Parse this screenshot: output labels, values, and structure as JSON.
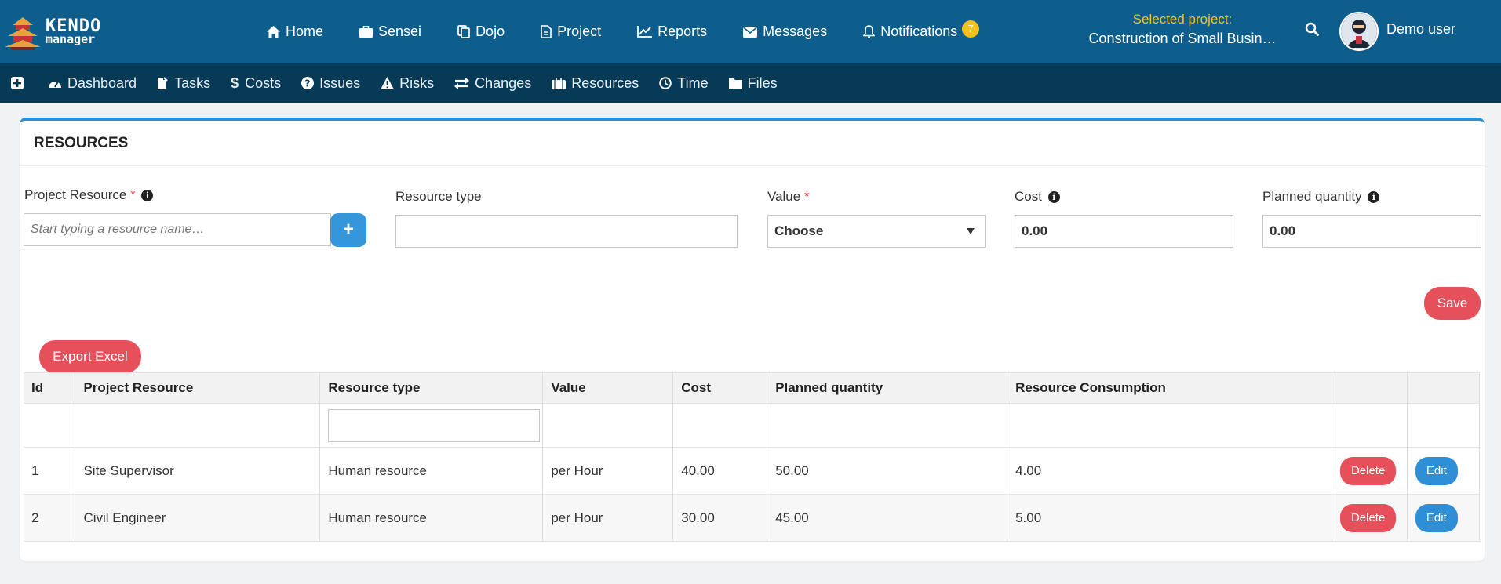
{
  "brand": {
    "line1": "KENDO",
    "line2": "manager"
  },
  "topnav": {
    "items": [
      {
        "label": "Home",
        "icon": "home-icon"
      },
      {
        "label": "Sensei",
        "icon": "briefcase-icon"
      },
      {
        "label": "Dojo",
        "icon": "copy-icon"
      },
      {
        "label": "Project",
        "icon": "file-icon"
      },
      {
        "label": "Reports",
        "icon": "line-chart-icon"
      },
      {
        "label": "Messages",
        "icon": "envelope-icon"
      },
      {
        "label": "Notifications",
        "icon": "bell-icon"
      }
    ],
    "notifications_count": "7",
    "selected_project_label": "Selected project:",
    "selected_project_name": "Construction of Small Busin…",
    "user_name": "Demo user"
  },
  "subnav": {
    "items": [
      {
        "label": "Dashboard",
        "icon": "dashboard-icon"
      },
      {
        "label": "Tasks",
        "icon": "tasks-icon"
      },
      {
        "label": "Costs",
        "icon": "dollar-icon"
      },
      {
        "label": "Issues",
        "icon": "question-icon"
      },
      {
        "label": "Risks",
        "icon": "warning-icon"
      },
      {
        "label": "Changes",
        "icon": "exchange-icon"
      },
      {
        "label": "Resources",
        "icon": "suitcase-icon"
      },
      {
        "label": "Time",
        "icon": "clock-icon"
      },
      {
        "label": "Files",
        "icon": "folder-icon"
      }
    ]
  },
  "panel": {
    "title": "RESOURCES",
    "form": {
      "project_resource_label": "Project Resource",
      "project_resource_placeholder": "Start typing a resource name…",
      "resource_type_label": "Resource type",
      "value_label": "Value",
      "value_selected": "Choose",
      "cost_label": "Cost",
      "cost_value": "0.00",
      "planned_quantity_label": "Planned quantity",
      "planned_quantity_value": "0.00",
      "required_mark": "*",
      "save_label": "Save"
    },
    "export_label": "Export Excel",
    "table": {
      "headers": [
        "Id",
        "Project Resource",
        "Resource type",
        "Value",
        "Cost",
        "Planned quantity",
        "Resource Consumption",
        "",
        ""
      ],
      "rows": [
        {
          "id": "1",
          "resource": "Site Supervisor",
          "type": "Human resource",
          "value": "per Hour",
          "cost": "40.00",
          "planned": "50.00",
          "consumption": "4.00"
        },
        {
          "id": "2",
          "resource": "Civil Engineer",
          "type": "Human resource",
          "value": "per Hour",
          "cost": "30.00",
          "planned": "45.00",
          "consumption": "5.00"
        }
      ],
      "delete_label": "Delete",
      "edit_label": "Edit"
    }
  }
}
